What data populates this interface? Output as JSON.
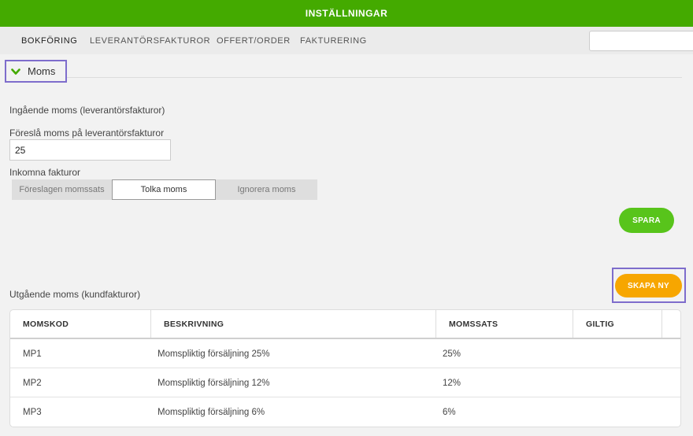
{
  "header": {
    "title": "INSTÄLLNINGAR"
  },
  "nav": {
    "tabs": [
      {
        "label": "BOKFÖRING",
        "active": true
      },
      {
        "label": "LEVERANTÖRSFAKTUROR",
        "active": false
      },
      {
        "label": "OFFERT/ORDER",
        "active": false
      },
      {
        "label": "FAKTURERING",
        "active": false
      }
    ],
    "search_value": ""
  },
  "section": {
    "title": "Moms",
    "icon": "chevron-down-icon",
    "icon_color": "#44aa00"
  },
  "incoming": {
    "heading": "Ingående moms (leverantörsfakturor)",
    "suggest_label": "Föreslå moms på leverantörsfakturor",
    "suggest_value": "25",
    "invoices_label": "Inkomna fakturor",
    "options": [
      "Föreslagen momssats",
      "Tolka moms",
      "Ignorera moms"
    ],
    "selected_option": "Tolka moms",
    "save_label": "SPARA"
  },
  "outgoing": {
    "heading": "Utgående moms (kundfakturor)",
    "create_label": "SKAPA NY",
    "columns": [
      "MOMSKOD",
      "BESKRIVNING",
      "MOMSSATS",
      "GILTIG"
    ],
    "rows": [
      [
        "MP1",
        "Momspliktig försäljning 25%",
        "25%",
        ""
      ],
      [
        "MP2",
        "Momspliktig försäljning 12%",
        "12%",
        ""
      ],
      [
        "MP3",
        "Momspliktig försäljning 6%",
        "6%",
        ""
      ]
    ]
  },
  "colors": {
    "header": "#44aa00",
    "save_button": "#58c41b",
    "create_button": "#f7a600",
    "highlight_frame": "#7e6dcc"
  }
}
